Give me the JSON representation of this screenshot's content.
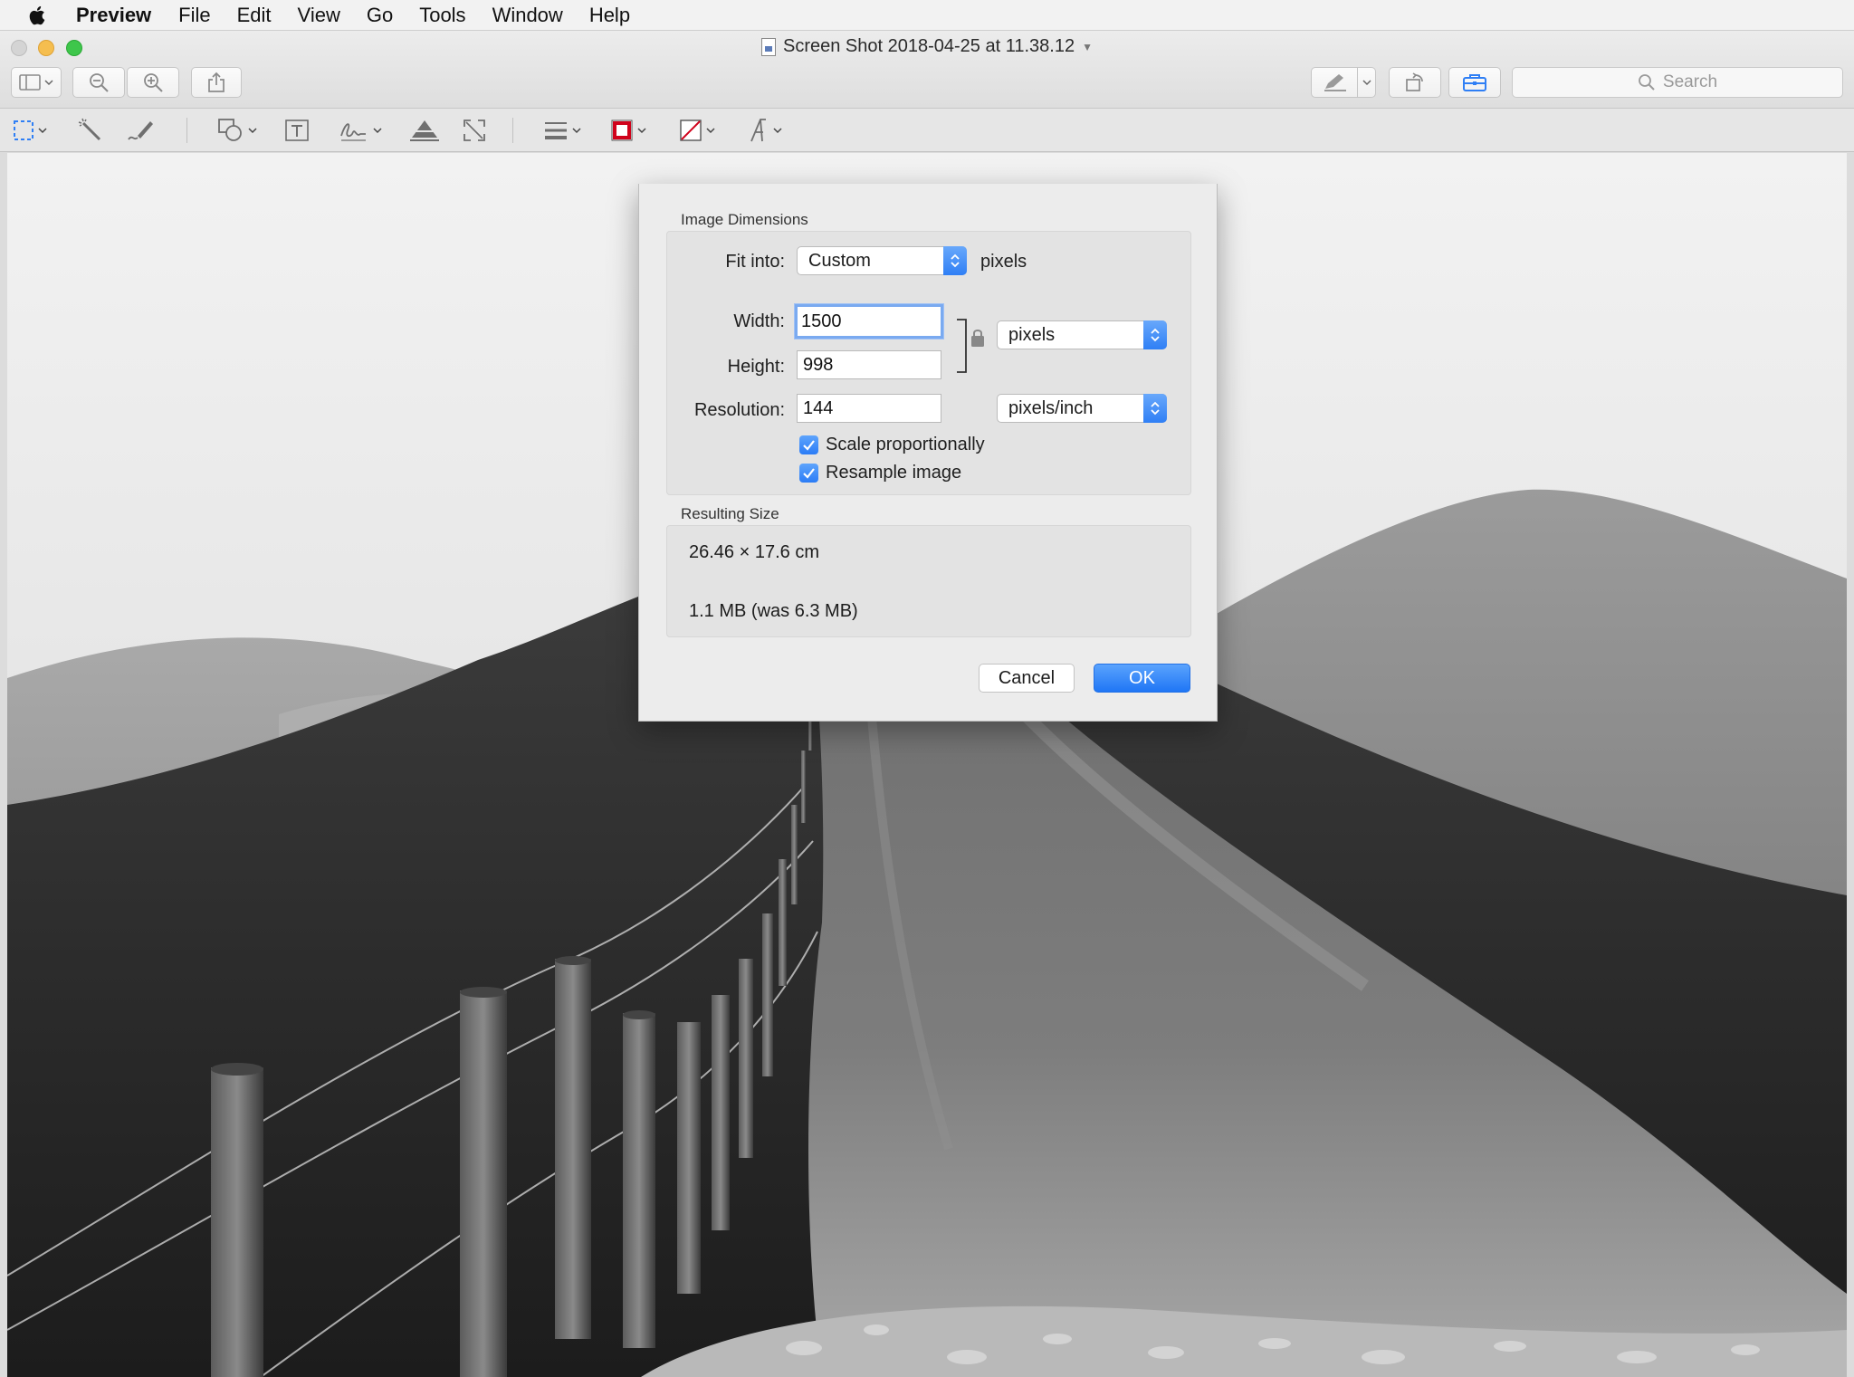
{
  "menubar": {
    "app_name": "Preview",
    "items": [
      "File",
      "Edit",
      "View",
      "Go",
      "Tools",
      "Window",
      "Help"
    ]
  },
  "window": {
    "title": "Screen Shot 2018-04-25 at 11.38.12"
  },
  "toolbar": {
    "search_placeholder": "Search"
  },
  "dialog": {
    "image_dimensions_label": "Image Dimensions",
    "fit_into_label": "Fit into:",
    "fit_into_value": "Custom",
    "fit_into_unit": "pixels",
    "width_label": "Width:",
    "width_value": "1500",
    "height_label": "Height:",
    "height_value": "998",
    "size_unit_value": "pixels",
    "resolution_label": "Resolution:",
    "resolution_value": "144",
    "resolution_unit_value": "pixels/inch",
    "scale_proportionally_label": "Scale proportionally",
    "scale_proportionally_checked": true,
    "resample_label": "Resample image",
    "resample_checked": true,
    "resulting_size_label": "Resulting Size",
    "resulting_dimensions": "26.46 × 17.6 cm",
    "resulting_file_size": "1.1 MB (was 6.3 MB)",
    "cancel_label": "Cancel",
    "ok_label": "OK"
  },
  "colors": {
    "accent": "#2f7ff5",
    "traffic_close": "#d4d4d4",
    "traffic_minimize": "#f5be4f",
    "traffic_zoom": "#3ec64b"
  }
}
